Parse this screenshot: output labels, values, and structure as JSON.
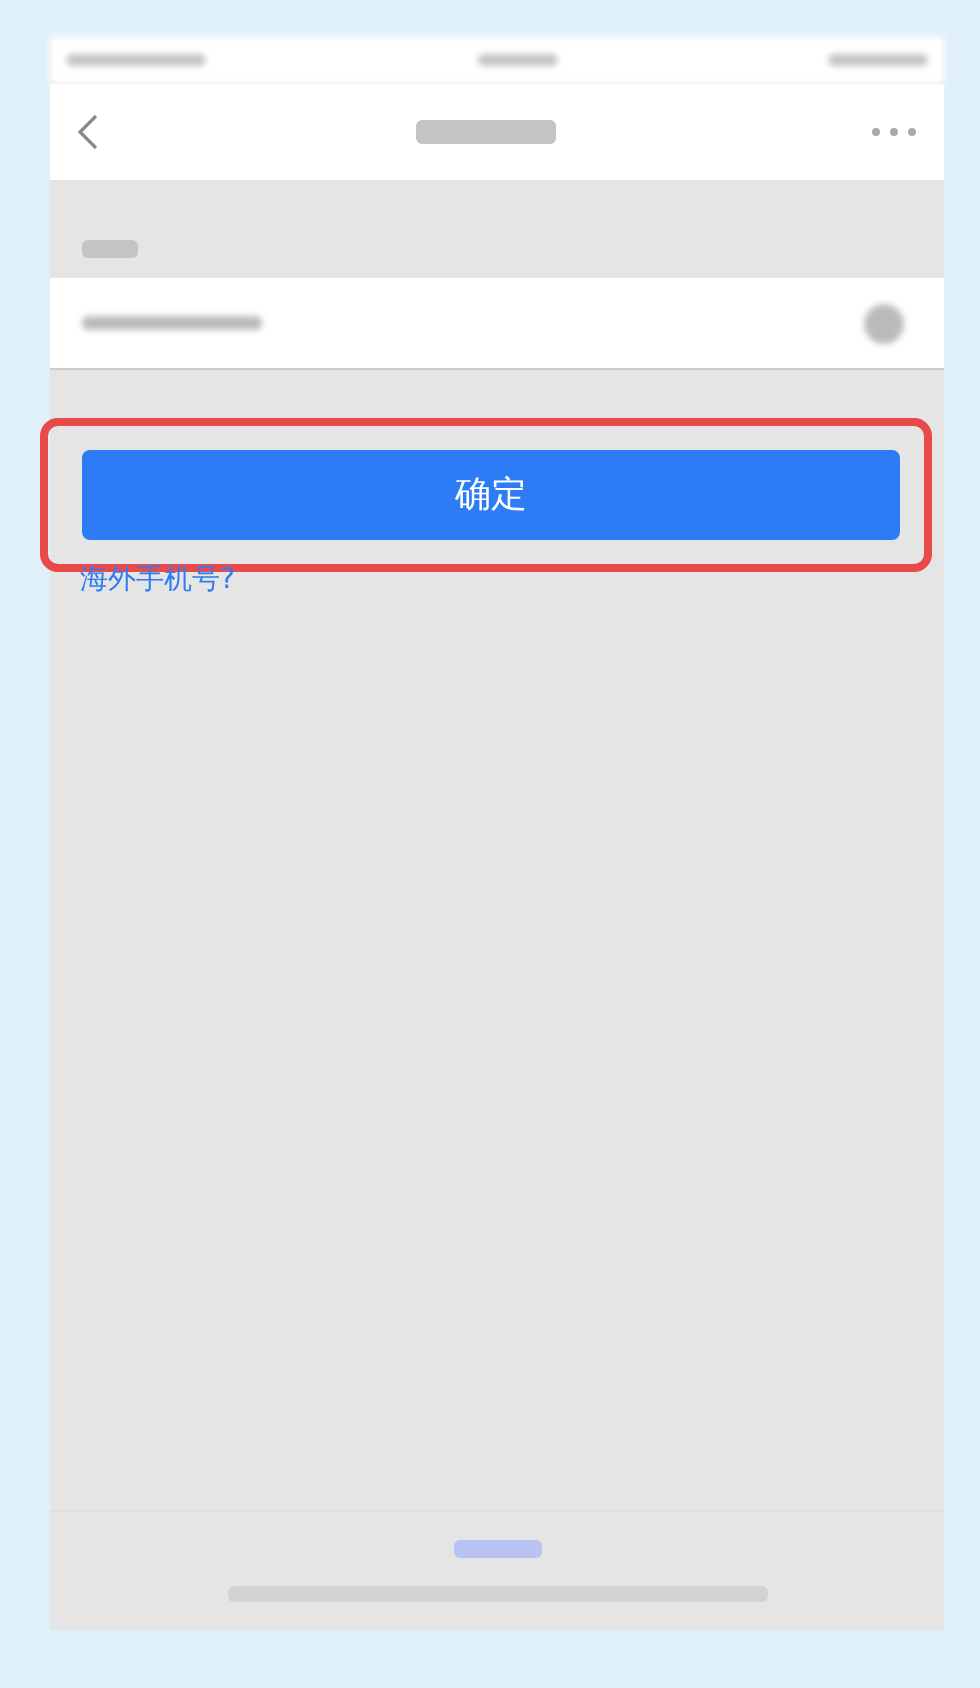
{
  "confirm_button": {
    "label": "确定",
    "highlighted": true
  },
  "overseas_link": "海外手机号?"
}
